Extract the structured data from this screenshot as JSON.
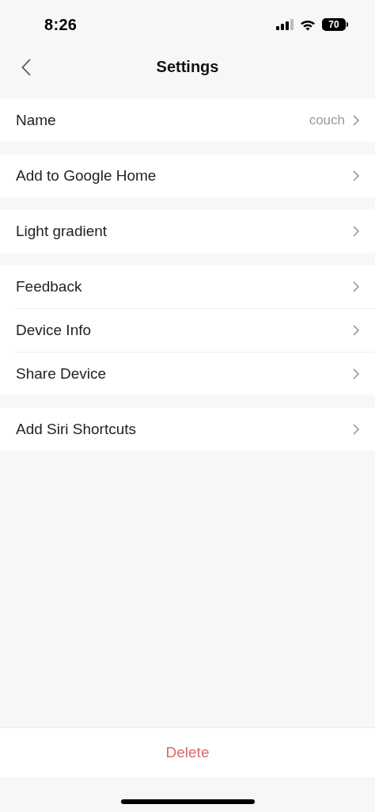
{
  "status_bar": {
    "time": "8:26",
    "battery": "70"
  },
  "nav": {
    "title": "Settings"
  },
  "groups": [
    {
      "items": [
        {
          "label": "Name",
          "value": "couch"
        }
      ]
    },
    {
      "items": [
        {
          "label": "Add to Google Home"
        }
      ]
    },
    {
      "items": [
        {
          "label": "Light gradient"
        }
      ]
    },
    {
      "items": [
        {
          "label": "Feedback"
        },
        {
          "label": "Device Info"
        },
        {
          "label": "Share Device"
        }
      ]
    },
    {
      "items": [
        {
          "label": "Add Siri Shortcuts"
        }
      ]
    }
  ],
  "delete_button": {
    "label": "Delete"
  }
}
